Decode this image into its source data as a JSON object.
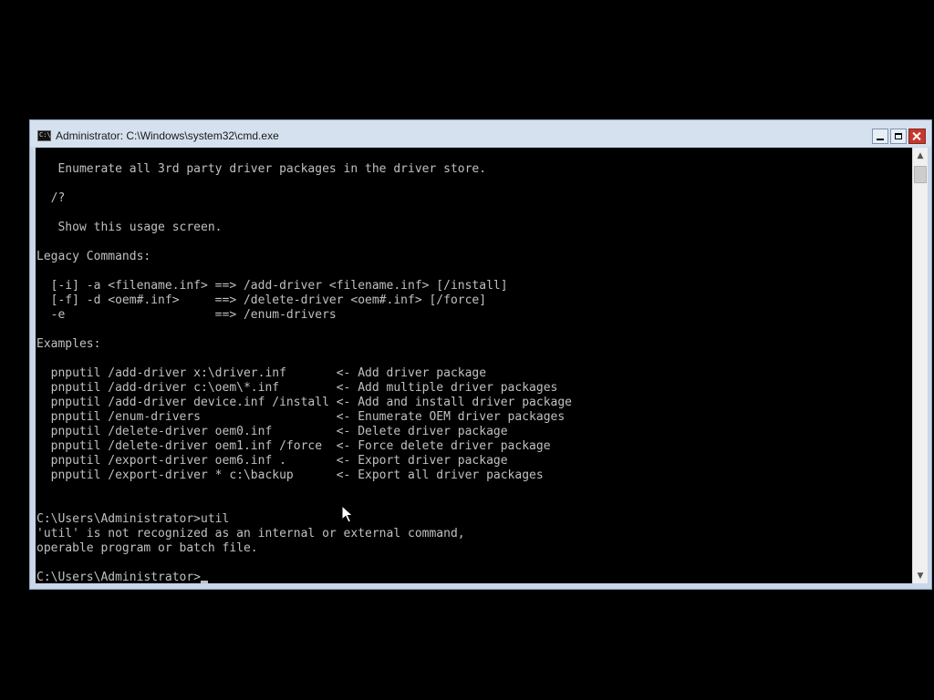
{
  "window": {
    "title": "Administrator: C:\\Windows\\system32\\cmd.exe",
    "app_icon_glyph": "C:\\",
    "controls": {
      "minimize": "minimize",
      "maximize": "maximize",
      "close": "close"
    }
  },
  "console": {
    "lines": [
      "   Enumerate all 3rd party driver packages in the driver store.",
      "",
      "  /?",
      "",
      "   Show this usage screen.",
      "",
      "Legacy Commands:",
      "",
      "  [-i] -a <filename.inf> ==> /add-driver <filename.inf> [/install]",
      "  [-f] -d <oem#.inf>     ==> /delete-driver <oem#.inf> [/force]",
      "  -e                     ==> /enum-drivers",
      "",
      "Examples:",
      "",
      "  pnputil /add-driver x:\\driver.inf       <- Add driver package",
      "  pnputil /add-driver c:\\oem\\*.inf        <- Add multiple driver packages",
      "  pnputil /add-driver device.inf /install <- Add and install driver package",
      "  pnputil /enum-drivers                   <- Enumerate OEM driver packages",
      "  pnputil /delete-driver oem0.inf         <- Delete driver package",
      "  pnputil /delete-driver oem1.inf /force  <- Force delete driver package",
      "  pnputil /export-driver oem6.inf .       <- Export driver package",
      "  pnputil /export-driver * c:\\backup      <- Export all driver packages",
      "",
      "",
      "C:\\Users\\Administrator>util",
      "'util' is not recognized as an internal or external command,",
      "operable program or batch file.",
      ""
    ],
    "prompt": "C:\\Users\\Administrator>",
    "text_color": "#c0c0c0",
    "background_color": "#000000"
  },
  "scrollbar": {
    "up_arrow": "▲",
    "down_arrow": "▼"
  },
  "colors": {
    "titlebar": "#d5e1ef",
    "window_frame": "#c9d7e8",
    "close_button": "#c8372d",
    "desktop": "#000000"
  }
}
